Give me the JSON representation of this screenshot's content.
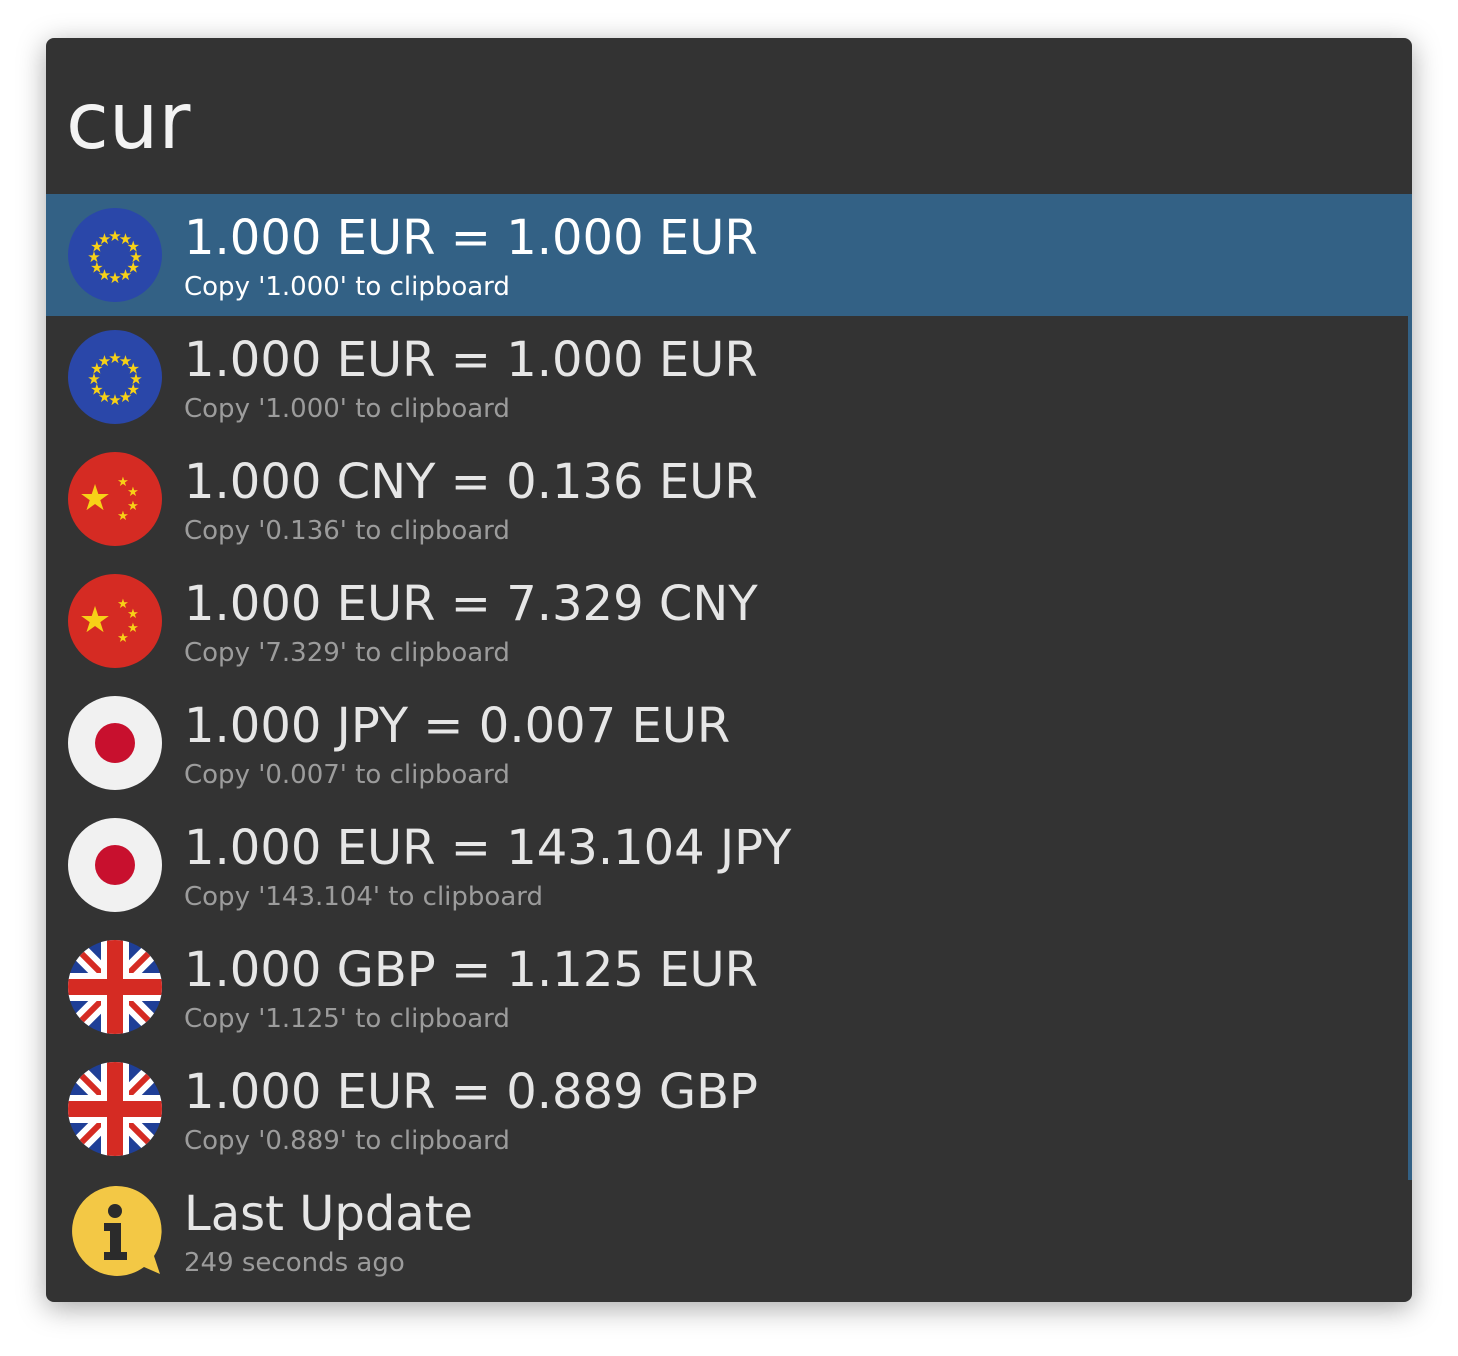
{
  "search": {
    "query": "cur"
  },
  "colors": {
    "selection": "#336185",
    "background": "#333333",
    "title": "#e6e6e6",
    "subtitle": "#9c9c9c"
  },
  "results": [
    {
      "title": "1.000 EUR = 1.000 EUR",
      "subtitle": "Copy '1.000' to clipboard",
      "icon": "eu-flag-icon",
      "selected": true
    },
    {
      "title": "1.000 EUR = 1.000 EUR",
      "subtitle": "Copy '1.000' to clipboard",
      "icon": "eu-flag-icon",
      "selected": false
    },
    {
      "title": "1.000 CNY = 0.136 EUR",
      "subtitle": "Copy '0.136' to clipboard",
      "icon": "china-flag-icon",
      "selected": false
    },
    {
      "title": "1.000 EUR = 7.329 CNY",
      "subtitle": "Copy '7.329' to clipboard",
      "icon": "china-flag-icon",
      "selected": false
    },
    {
      "title": "1.000 JPY = 0.007 EUR",
      "subtitle": "Copy '0.007' to clipboard",
      "icon": "japan-flag-icon",
      "selected": false
    },
    {
      "title": "1.000 EUR = 143.104 JPY",
      "subtitle": "Copy '143.104' to clipboard",
      "icon": "japan-flag-icon",
      "selected": false
    },
    {
      "title": "1.000 GBP = 1.125 EUR",
      "subtitle": "Copy '1.125' to clipboard",
      "icon": "uk-flag-icon",
      "selected": false
    },
    {
      "title": "1.000 EUR = 0.889 GBP",
      "subtitle": "Copy '0.889' to clipboard",
      "icon": "uk-flag-icon",
      "selected": false
    },
    {
      "title": "Last Update",
      "subtitle": "249 seconds ago",
      "icon": "info-icon",
      "selected": false
    }
  ]
}
